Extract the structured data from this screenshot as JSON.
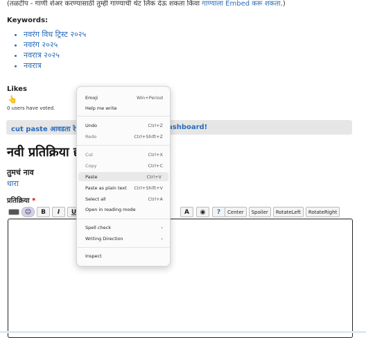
{
  "tip": {
    "prefix": "(तळटीप - गाणी शेअर करण्यासाठी तुम्ही गाण्याची थेट लिंक देऊ शकता किंवा ",
    "link": "गाण्याला Embed करू शकता",
    "suffix": ".)"
  },
  "keywords": {
    "title": "Keywords:",
    "items": [
      "नवरंग विध ट्रिस्ट २०२५",
      "नवरंग २०२५",
      "नवरात्र २०२५",
      "नवरात्र"
    ]
  },
  "likes": {
    "title": "Likes",
    "hand": "👆",
    "votes": "0 users have voted."
  },
  "bar": {
    "text": "cut  paste  आवडता रे",
    "text2": "ashboard!"
  },
  "comment": {
    "heading": "नवी प्रतिक्रिया द्या",
    "name_label": "तुमचं नाव",
    "name_value": "धारा",
    "response_label": "प्रतिक्रिया",
    "required": "*"
  },
  "toolbar": {
    "bold": "B",
    "italic": "I",
    "underline": "U",
    "right_buttons": [
      "Center",
      "Spoiler",
      "RotateLeft",
      "RotateRight"
    ]
  },
  "menu": {
    "emoji": "Emoji",
    "emoji_sc": "Win+Period",
    "help": "Help me write",
    "undo": "Undo",
    "undo_sc": "Ctrl+Z",
    "redo": "Redo",
    "redo_sc": "Ctrl+Shift+Z",
    "cut": "Cut",
    "cut_sc": "Ctrl+X",
    "copy": "Copy",
    "copy_sc": "Ctrl+C",
    "paste": "Paste",
    "paste_sc": "Ctrl+V",
    "paste_plain": "Paste as plain text",
    "paste_plain_sc": "Ctrl+Shift+V",
    "select_all": "Select all",
    "select_all_sc": "Ctrl+A",
    "reading": "Open in reading mode",
    "spell": "Spell check",
    "writing": "Writing Direction",
    "inspect": "Inspect",
    "arrow": "›"
  }
}
